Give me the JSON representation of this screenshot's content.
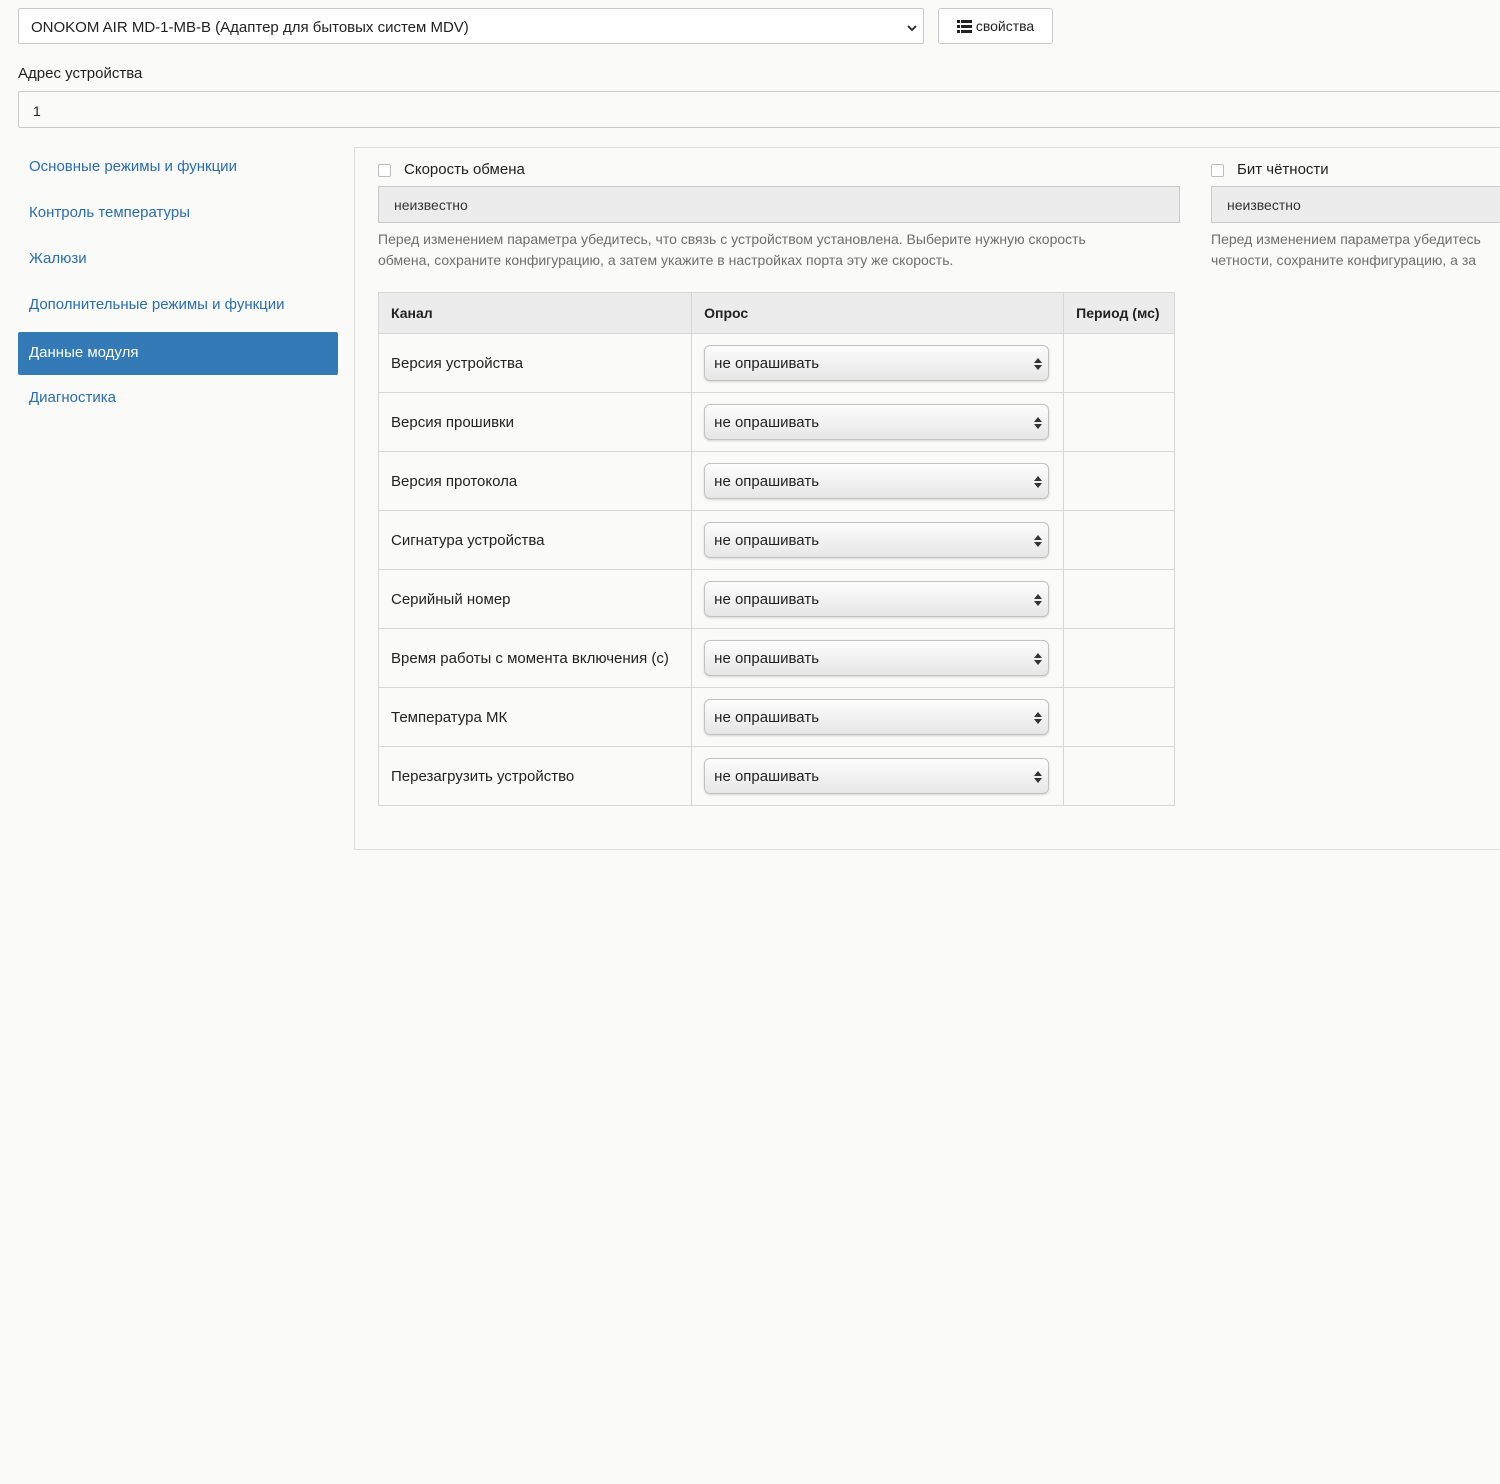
{
  "header": {
    "device_select_value": "ONOKOM AIR MD-1-MB-B (Адаптер для бытовых систем MDV)",
    "properties_button": "свойства",
    "address_label": "Адрес устройства",
    "address_value": "1"
  },
  "sidebar": {
    "items": [
      {
        "label": "Основные режимы и функции",
        "active": false
      },
      {
        "label": "Контроль температуры",
        "active": false
      },
      {
        "label": "Жалюзи",
        "active": false
      },
      {
        "label": "Дополнительные режимы и функции",
        "active": false
      },
      {
        "label": "Данные модуля",
        "active": true
      },
      {
        "label": "Диагностика",
        "active": false
      }
    ]
  },
  "baud": {
    "label": "Скорость обмена",
    "checked": false,
    "value": "неизвестно",
    "help_line1": "Перед изменением параметра убедитесь, что связь с устройством установлена. Выберите нужную скорость",
    "help_line2": "обмена, сохраните конфигурацию, а затем укажите в настройках порта эту же скорость."
  },
  "parity": {
    "label": "Бит чётности",
    "checked": false,
    "value": "неизвестно",
    "help_line1": "Перед изменением параметра убедитесь",
    "help_line2": "четности, сохраните конфигурацию, а за"
  },
  "table": {
    "headers": [
      "Канал",
      "Опрос",
      "Период (мс)"
    ],
    "rows": [
      {
        "channel": "Версия устройства",
        "poll": "не опрашивать",
        "period": ""
      },
      {
        "channel": "Версия прошивки",
        "poll": "не опрашивать",
        "period": ""
      },
      {
        "channel": "Версия протокола",
        "poll": "не опрашивать",
        "period": ""
      },
      {
        "channel": "Сигнатура устройства",
        "poll": "не опрашивать",
        "period": ""
      },
      {
        "channel": "Серийный номер",
        "poll": "не опрашивать",
        "period": ""
      },
      {
        "channel": "Время работы с момента включения (с)",
        "poll": "не опрашивать",
        "period": ""
      },
      {
        "channel": "Температура МК",
        "poll": "не опрашивать",
        "period": ""
      },
      {
        "channel": "Перезагрузить устройство",
        "poll": "не опрашивать",
        "period": ""
      }
    ]
  },
  "colors": {
    "accent": "#337ab7",
    "link": "#2a6db0"
  }
}
